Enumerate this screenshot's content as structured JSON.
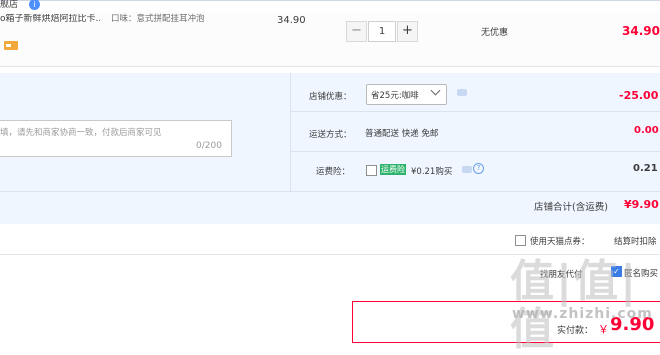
{
  "store": {
    "name": "舰店",
    "info_icon": "i"
  },
  "item": {
    "title": "o箱子新鲜烘焙阿拉比卡...",
    "attributes": "口味：意式拼配挂耳冲泡",
    "unit_price": "34.90",
    "quantity": "1",
    "minus": "−",
    "plus": "+",
    "discount": "无优惠",
    "subtotal": "34.90",
    "payment_icon": "credit-card-icon"
  },
  "order": {
    "memo_placeholder": "填，请先和商家协商一致，付款后商家可见",
    "memo_count": "0/200",
    "coupon_label": "店铺优惠：",
    "coupon_selected": "省25元:咖啡",
    "coupon_amount": "-25.00",
    "shipping_label": "运送方式：",
    "shipping_method": "普通配送 快递 免邮",
    "shipping_amount": "0.00",
    "insurance_label": "运费险：",
    "insurance_tag": "运费险",
    "insurance_price": "¥0.21购买",
    "insurance_help": "?",
    "insurance_amount": "0.21",
    "total_label": "店铺合计(含运费)",
    "total_amount": "¥9.90"
  },
  "checkout": {
    "tmall_coupon_label": "使用天猫点券：",
    "settle_label": "结算时扣除",
    "proxy_pay_label": "找朋友代付",
    "anon_check": "✓",
    "anonymous_label": "匿名购买",
    "pay_label": "实付款：",
    "pay_currency": "￥",
    "pay_amount": "9.90"
  },
  "watermark": {
    "logo": "值|值|值",
    "url": "www.zhizhi.com"
  },
  "colors": {
    "price_red": "#ff0036",
    "panel_bg": "#eff6ff",
    "accent_blue": "#3b7be8",
    "insurance_green": "#2eb36b"
  }
}
